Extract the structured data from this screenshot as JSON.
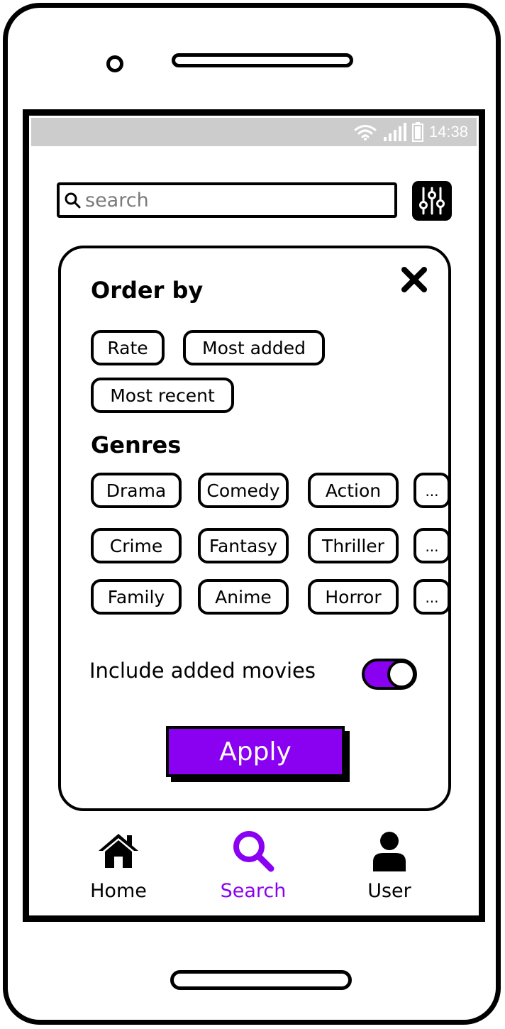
{
  "status_bar": {
    "time": "14:38",
    "icons": [
      "wifi-icon",
      "signal-icon",
      "battery-icon"
    ]
  },
  "search": {
    "placeholder": "search"
  },
  "filters": {
    "order_title": "Order by",
    "order_options": [
      "Rate",
      "Most added",
      "Most recent"
    ],
    "genres_title": "Genres",
    "genres": [
      [
        "Drama",
        "Comedy",
        "Action",
        "..."
      ],
      [
        "Crime",
        "Fantasy",
        "Thriller",
        "..."
      ],
      [
        "Family",
        "Anime",
        "Horror",
        "..."
      ]
    ],
    "toggle_label": "Include added movies",
    "toggle_on": true,
    "apply_label": "Apply"
  },
  "nav": {
    "items": [
      {
        "label": "Home",
        "icon": "home-icon",
        "active": false
      },
      {
        "label": "Search",
        "icon": "search-icon",
        "active": true
      },
      {
        "label": "User",
        "icon": "user-icon",
        "active": false
      }
    ]
  },
  "colors": {
    "accent": "#8a00f0",
    "status_bar": "#cccccc"
  }
}
